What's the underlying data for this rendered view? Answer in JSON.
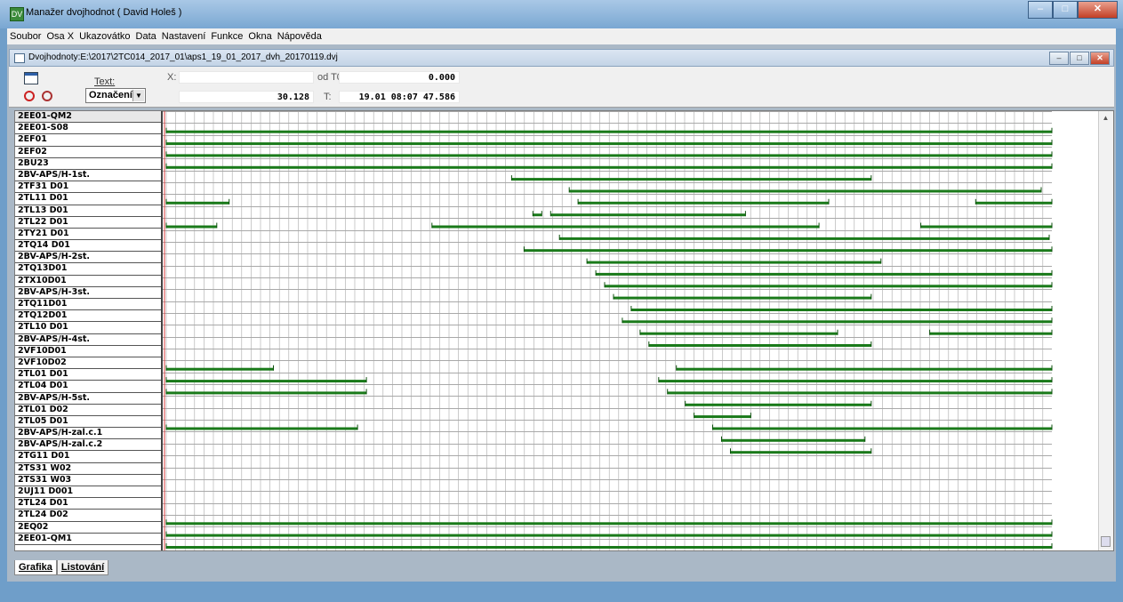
{
  "window": {
    "title": "Manažer dvojhodnot ( David Holeš )",
    "app_icon": "DV",
    "minimize": "–",
    "maximize": "□",
    "close": "✕"
  },
  "menu": [
    "Soubor",
    "Osa X",
    "Ukazovátko",
    "Data",
    "Nastavení",
    "Funkce",
    "Okna",
    "Nápověda"
  ],
  "child": {
    "title": "Dvojhodnoty:E:\\2017\\2TC014_2017_01\\aps1_19_01_2017_dvh_20170119.dvj",
    "minimize": "–",
    "maximize": "□",
    "close": "✕"
  },
  "toolbar": {
    "text_label": "Text:",
    "select_value": "Označení",
    "x_label": "X:",
    "x_value": "",
    "x_second_value": "30.128",
    "odt0_label": "od T0:",
    "odt0_value": "0.000",
    "t_label": "T:",
    "t_value": "19.01  08:07 47.586"
  },
  "signals": [
    "2EE01-QM2",
    "2EE01-S08",
    "2EF01",
    "2EF02",
    "2BU23",
    "2BV-APS/H-1st.",
    "2TF31 D01",
    "2TL11 D01",
    "2TL13 D01",
    "2TL22 D01",
    "2TY21 D01",
    "2TQ14 D01",
    "2BV-APS/H-2st.",
    "2TQ13D01",
    "2TX10D01",
    "2BV-APS/H-3st.",
    "2TQ11D01",
    "2TQ12D01",
    "2TL10 D01",
    "2BV-APS/H-4st.",
    "2VF10D01",
    "2VF10D02",
    "2TL01 D01",
    "2TL04 D01",
    "2BV-APS/H-5st.",
    "2TL01 D02",
    "2TL05 D01",
    "2BV-APS/H-zal.c.1",
    "2BV-APS/H-zal.c.2",
    "2TG11 D01",
    "2TS31 W02",
    "2TS31 W03",
    "2UJ11 D001",
    "2TL24 D01",
    "2TL24 D02",
    "2EQ02",
    "2EE01-QM1"
  ],
  "bars": [
    [],
    [
      [
        0,
        1
      ]
    ],
    [
      [
        0,
        1
      ]
    ],
    [
      [
        0,
        1
      ]
    ],
    [
      [
        0,
        1
      ]
    ],
    [
      [
        0.39,
        0.796
      ]
    ],
    [
      [
        0.455,
        0.988
      ]
    ],
    [
      [
        0,
        0.071
      ],
      [
        0.465,
        0.748
      ],
      [
        0.914,
        1
      ]
    ],
    [
      [
        0.414,
        0.424
      ],
      [
        0.434,
        0.654
      ]
    ],
    [
      [
        0,
        0.057
      ],
      [
        0.3,
        0.737
      ],
      [
        0.852,
        1
      ]
    ],
    [
      [
        0.444,
        0.997
      ]
    ],
    [
      [
        0.404,
        1
      ]
    ],
    [
      [
        0.475,
        0.807
      ]
    ],
    [
      [
        0.485,
        1
      ]
    ],
    [
      [
        0.495,
        1
      ]
    ],
    [
      [
        0.505,
        0.796
      ]
    ],
    [
      [
        0.525,
        1
      ]
    ],
    [
      [
        0.515,
        1
      ]
    ],
    [
      [
        0.535,
        0.758
      ],
      [
        0.862,
        1
      ]
    ],
    [
      [
        0.545,
        0.796
      ]
    ],
    [],
    [
      [
        0,
        0.121
      ],
      [
        0.576,
        1
      ]
    ],
    [
      [
        0,
        0.226
      ],
      [
        0.556,
        1
      ]
    ],
    [
      [
        0,
        0.226
      ],
      [
        0.566,
        1
      ]
    ],
    [
      [
        0.586,
        0.796
      ]
    ],
    [
      [
        0.596,
        0.66
      ]
    ],
    [
      [
        0,
        0.216
      ],
      [
        0.617,
        1
      ]
    ],
    [
      [
        0.627,
        0.789
      ]
    ],
    [
      [
        0.637,
        0.796
      ]
    ],
    [],
    [],
    [],
    [],
    [],
    [
      [
        0,
        1
      ]
    ],
    [
      [
        0,
        1
      ]
    ],
    [
      [
        0,
        1
      ]
    ]
  ],
  "colors": {
    "bar": "#1a7a1a",
    "bar_dark": "#0d4f0d",
    "grid": "#a9a9a9",
    "cursor": "#e04040"
  },
  "tabs": [
    "Grafika",
    "Listování"
  ],
  "icons": {
    "calendar": "calendar-icon",
    "clock": "clock-icon",
    "stopwatch": "stopwatch-icon",
    "dropdown": "chevron-down-icon"
  }
}
